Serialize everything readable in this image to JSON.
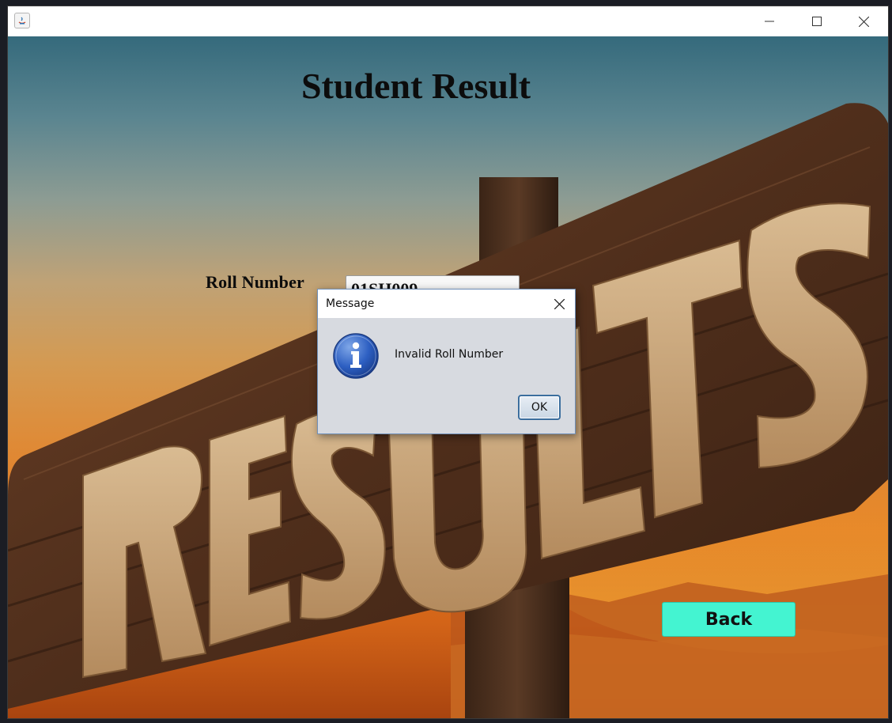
{
  "window": {
    "min_icon": "minimize-icon",
    "max_icon": "maximize-icon",
    "close_icon": "close-icon",
    "app_icon": "java-icon"
  },
  "page": {
    "title": "Student Result",
    "roll_label": "Roll Number",
    "roll_value": "01SH009",
    "back_label": "Back",
    "back_color": "#44f4d1"
  },
  "background": {
    "sign_text": "RESULTS",
    "colors": {
      "sky_top": "#356a7c",
      "sunset": "#e37a22",
      "wood": "#5a3520",
      "letters": "#c9a67a"
    }
  },
  "dialog": {
    "title": "Message",
    "message": "Invalid Roll Number",
    "ok_label": "OK",
    "icon": "info-icon"
  }
}
